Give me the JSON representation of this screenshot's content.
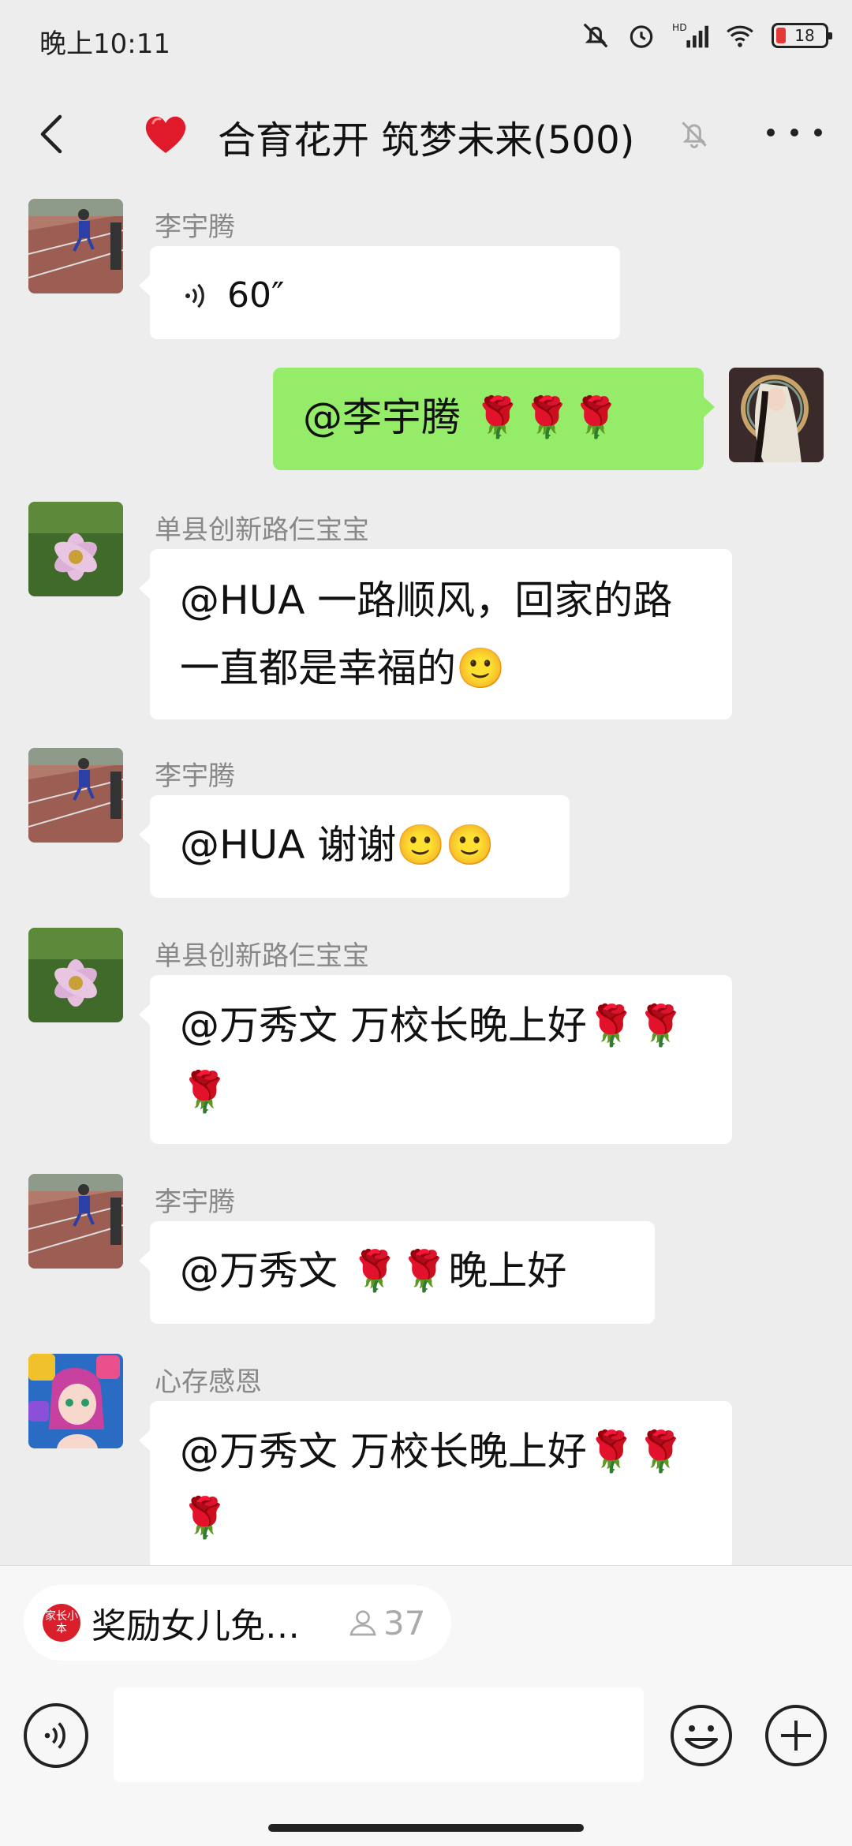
{
  "status_bar": {
    "time": "晚上10:11",
    "battery": "18",
    "icons": [
      "mute-bell-icon",
      "alarm-icon",
      "hd-signal-icon",
      "wifi-icon",
      "battery-icon"
    ]
  },
  "header": {
    "title": "合育花开 筑梦未来(500)",
    "icons": [
      "back-icon",
      "heart-icon",
      "mute-icon",
      "more-icon"
    ]
  },
  "messages": [
    {
      "sender": "李宇腾",
      "type": "voice",
      "duration": "60″",
      "own": false
    },
    {
      "sender": "",
      "text": "@李宇腾 🌹🌹🌹",
      "own": true
    },
    {
      "sender": "单县创新路仨宝宝",
      "text": "@HUA 一路顺风，回家的路一直都是幸福的🙂",
      "own": false
    },
    {
      "sender": "李宇腾",
      "text": "@HUA 谢谢🙂🙂",
      "own": false
    },
    {
      "sender": "单县创新路仨宝宝",
      "text": "@万秀文 万校长晚上好🌹🌹🌹",
      "own": false
    },
    {
      "sender": "李宇腾",
      "text": "@万秀文 🌹🌹晚上好",
      "own": false
    },
    {
      "sender": "心存感恩",
      "text": " @万秀文 万校长晚上好🌹🌹🌹",
      "own": false
    }
  ],
  "notice": {
    "logo_text": "家长小本",
    "title": "奖励女儿免…",
    "count": "37"
  },
  "input": {
    "placeholder": ""
  },
  "colors": {
    "own_bubble": "#95ec69",
    "background": "#ededed",
    "rose": "#d91e2c"
  }
}
